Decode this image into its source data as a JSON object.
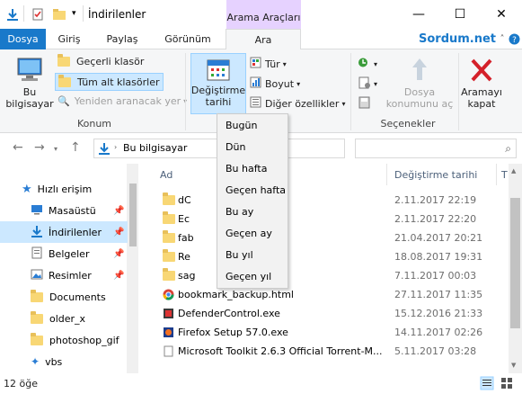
{
  "titlebar": {
    "title": "İndirilenler",
    "contextual_tab": "Arama Araçları",
    "min": "—",
    "max": "☐",
    "close": "✕"
  },
  "ribbon_tabs": {
    "dosya": "Dosya",
    "giris": "Giriş",
    "paylas": "Paylaş",
    "gorunum": "Görünüm",
    "ara": "Ara",
    "watermark": "Sordum.net"
  },
  "ribbon": {
    "konum": {
      "bu_bilgisayar": [
        "Bu",
        "bilgisayar"
      ],
      "gecerli_klasor": "Geçerli klasör",
      "tum_alt_klasorler": "Tüm alt klasörler",
      "yeniden_aranacak": "Yeniden aranacak yer",
      "label": "Konum"
    },
    "refine": {
      "degistirme_tarihi": [
        "Değiştirme",
        "tarihi"
      ],
      "tur": "Tür",
      "boyut": "Boyut",
      "diger_ozellikler": "Diğer özellikler"
    },
    "secenekler": {
      "dosya_konumu_ac": [
        "Dosya",
        "konumunu aç"
      ],
      "label": "Seçenekler"
    },
    "aramayi_kapat": [
      "Aramayı",
      "kapat"
    ]
  },
  "nav": {
    "breadcrumb": "Bu bilgisayar",
    "back": "←",
    "forward": "→",
    "up": "↑",
    "refresh": "↻"
  },
  "sidebar": {
    "items": [
      {
        "label": "Hızlı erişim",
        "icon": "star-icon"
      },
      {
        "label": "Masaüstü",
        "icon": "desktop-icon"
      },
      {
        "label": "İndirilenler",
        "icon": "download-icon"
      },
      {
        "label": "Belgeler",
        "icon": "documents-icon"
      },
      {
        "label": "Resimler",
        "icon": "pictures-icon"
      },
      {
        "label": "Documents",
        "icon": "folder-icon"
      },
      {
        "label": "older_x",
        "icon": "folder-icon"
      },
      {
        "label": "photoshop_gif",
        "icon": "folder-icon"
      },
      {
        "label": "vbs",
        "icon": "star-icon"
      }
    ]
  },
  "filelist": {
    "col_name": "Ad",
    "col_date": "Değiştirme tarihi",
    "col_type": "T",
    "rows": [
      {
        "name": "dC",
        "date": "2.11.2017 22:19",
        "icon": "folder-icon"
      },
      {
        "name": "Ec",
        "date": "2.11.2017 22:20",
        "icon": "folder-icon"
      },
      {
        "name": "fab",
        "date": "21.04.2017 20:21",
        "icon": "folder-icon"
      },
      {
        "name": "Re",
        "date": "18.08.2017 19:31",
        "icon": "folder-icon"
      },
      {
        "name": "sag",
        "date": "7.11.2017 00:03",
        "icon": "folder-icon"
      },
      {
        "name": "bookmark_backup.html",
        "date": "27.11.2017 11:35",
        "icon": "chrome-icon"
      },
      {
        "name": "DefenderControl.exe",
        "date": "15.12.2016 21:33",
        "icon": "exe-icon"
      },
      {
        "name": "Firefox Setup 57.0.exe",
        "date": "14.11.2017 02:26",
        "icon": "firefox-icon"
      },
      {
        "name": "Microsoft Toolkit 2.6.3 Official Torrent-M...",
        "date": "5.11.2017 03:28",
        "icon": "file-icon"
      }
    ]
  },
  "dropdown": {
    "items": [
      "Bugün",
      "Dün",
      "Bu hafta",
      "Geçen hafta",
      "Bu ay",
      "Geçen ay",
      "Bu yıl",
      "Geçen yıl"
    ]
  },
  "status": {
    "count": "12 öğe"
  },
  "colors": {
    "accent": "#1979ca",
    "contextual": "#e6d2ff",
    "selected": "#cce8ff",
    "folder": "#f8d775"
  }
}
